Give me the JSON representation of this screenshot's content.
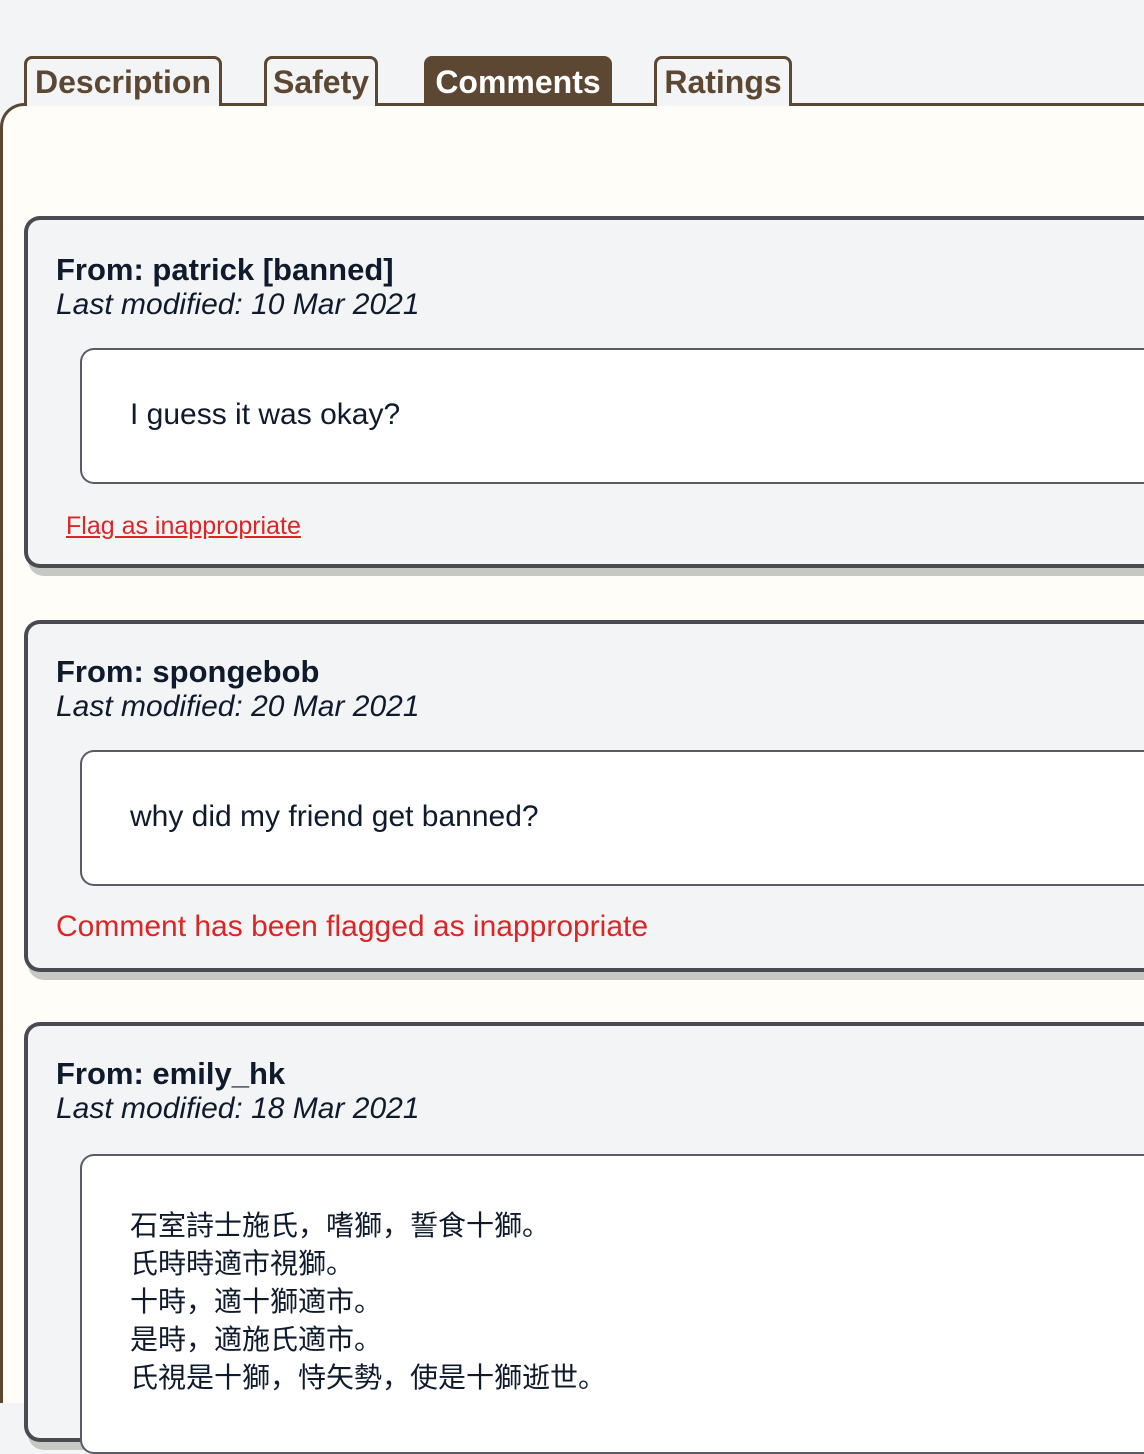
{
  "tabs": [
    {
      "label": "Description",
      "active": false
    },
    {
      "label": "Safety",
      "active": false
    },
    {
      "label": "Comments",
      "active": true
    },
    {
      "label": "Ratings",
      "active": false
    }
  ],
  "comments": [
    {
      "from": "From: patrick [banned]",
      "modified": "Last modified: 10 Mar 2021",
      "text": "I guess it was okay?",
      "flag_link": "Flag as inappropriate"
    },
    {
      "from": "From: spongebob",
      "modified": "Last modified: 20 Mar 2021",
      "text": "why did my friend get banned?",
      "flagged_message": "Comment has been flagged as inappropriate"
    },
    {
      "from": "From: emily_hk",
      "modified": "Last modified: 18 Mar 2021",
      "lines": [
        "石室詩士施氏，嗜獅，誓食十獅。",
        "氏時時適市視獅。",
        "十時，適十獅適市。",
        "是時，適施氏適市。",
        "氏視是十獅，恃矢勢，使是十獅逝世。"
      ]
    }
  ],
  "colors": {
    "tab_brown": "#5c4733",
    "flag_red": "#dc2626",
    "card_border": "#4a4a52"
  }
}
